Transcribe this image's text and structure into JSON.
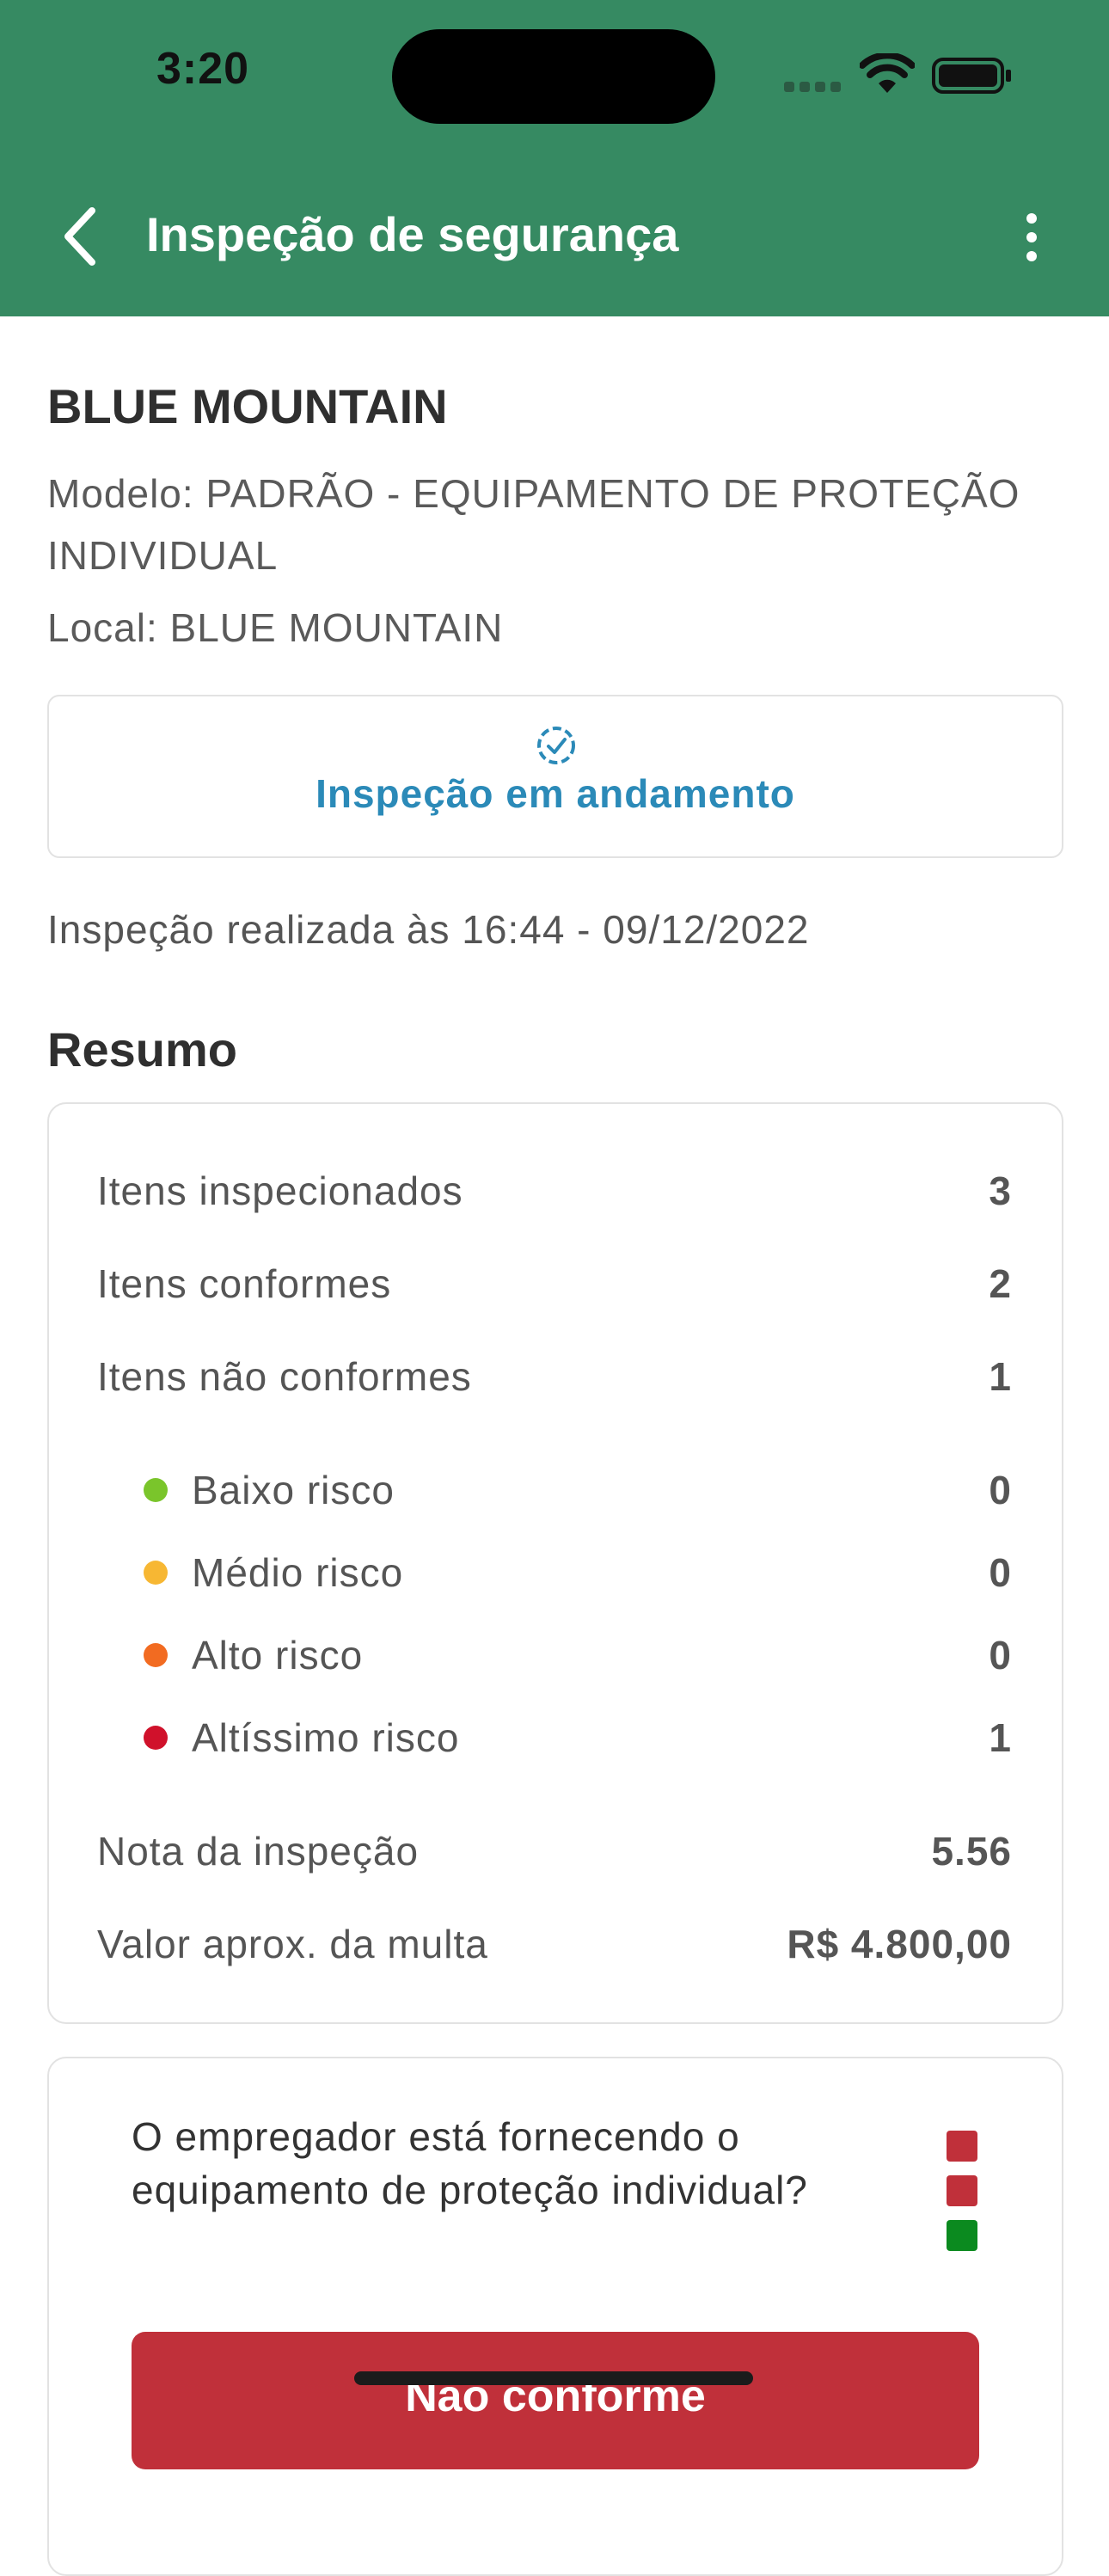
{
  "status_bar": {
    "time": "3:20"
  },
  "header": {
    "title": "Inspeção de segurança"
  },
  "site": {
    "name": "BLUE MOUNTAIN",
    "model": "Modelo: PADRÃO - EQUIPAMENTO DE PROTEÇÃO INDIVIDUAL",
    "local": "Local: BLUE MOUNTAIN"
  },
  "inspection_status": {
    "text": "Inspeção em andamento",
    "color": "#2b8ab8"
  },
  "performed": "Inspeção realizada às 16:44 - 09/12/2022",
  "summary": {
    "title": "Resumo",
    "rows": [
      {
        "label": "Itens inspecionados",
        "value": "3"
      },
      {
        "label": "Itens conformes",
        "value": "2"
      },
      {
        "label": "Itens não conformes",
        "value": "1"
      }
    ],
    "risks": [
      {
        "label": "Baixo risco",
        "value": "0",
        "color": "#7ac52b"
      },
      {
        "label": "Médio risco",
        "value": "0",
        "color": "#f7b733"
      },
      {
        "label": "Alto risco",
        "value": "0",
        "color": "#f26b21"
      },
      {
        "label": "Altíssimo risco",
        "value": "1",
        "color": "#d0112b"
      }
    ],
    "score": {
      "label": "Nota da inspeção",
      "value": "5.56"
    },
    "fine": {
      "label": "Valor aprox. da multa",
      "value": "R$ 4.800,00"
    }
  },
  "question": {
    "text": "O empregador está fornecendo o equipamento de proteção individual?",
    "indicators": [
      "#c0303a",
      "#c0303a",
      "#0b8a1f"
    ],
    "button_label": "Não conforme"
  },
  "colors": {
    "header_bg": "#368a62",
    "danger": "#c0303a"
  }
}
